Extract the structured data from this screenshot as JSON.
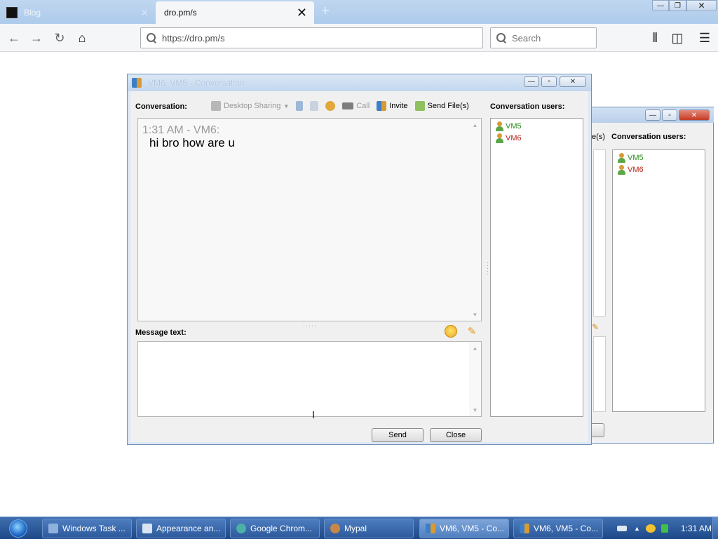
{
  "browser": {
    "tabs": [
      {
        "title": "Blog",
        "active": false
      },
      {
        "title": "dro.pm/s",
        "active": true
      }
    ],
    "url": "https://dro.pm/s",
    "search_placeholder": "Search"
  },
  "conversation_window": {
    "title": "VM6, VM5 - Conversation",
    "conversation_label": "Conversation:",
    "toolbar": {
      "desktop_sharing": "Desktop Sharing",
      "call": "Call",
      "invite": "Invite",
      "send_files": "Send File(s)"
    },
    "messages": [
      {
        "meta": "1:31 AM - VM6:",
        "text": "hi bro how are u"
      }
    ],
    "message_label": "Message text:",
    "message_value": "",
    "users_label": "Conversation users:",
    "users": [
      "VM5",
      "VM6"
    ],
    "send_label": "Send",
    "close_label": "Close"
  },
  "background_window": {
    "partial_label": "e(s)",
    "users_label": "Conversation users:",
    "users": [
      "VM5",
      "VM6"
    ]
  },
  "taskbar": {
    "items": [
      {
        "label": "Windows Task ...",
        "active": false
      },
      {
        "label": "Appearance an...",
        "active": false
      },
      {
        "label": "Google Chrom...",
        "active": false
      },
      {
        "label": "Mypal",
        "active": false
      },
      {
        "label": "VM6, VM5 - Co...",
        "active": true
      },
      {
        "label": "VM6, VM5 - Co...",
        "active": false
      }
    ],
    "clock": "1:31 AM"
  },
  "colors": {
    "user_vm5": "#2a8a1f",
    "user_vm6": "#b3281d",
    "taskbar": "#1d4888"
  }
}
